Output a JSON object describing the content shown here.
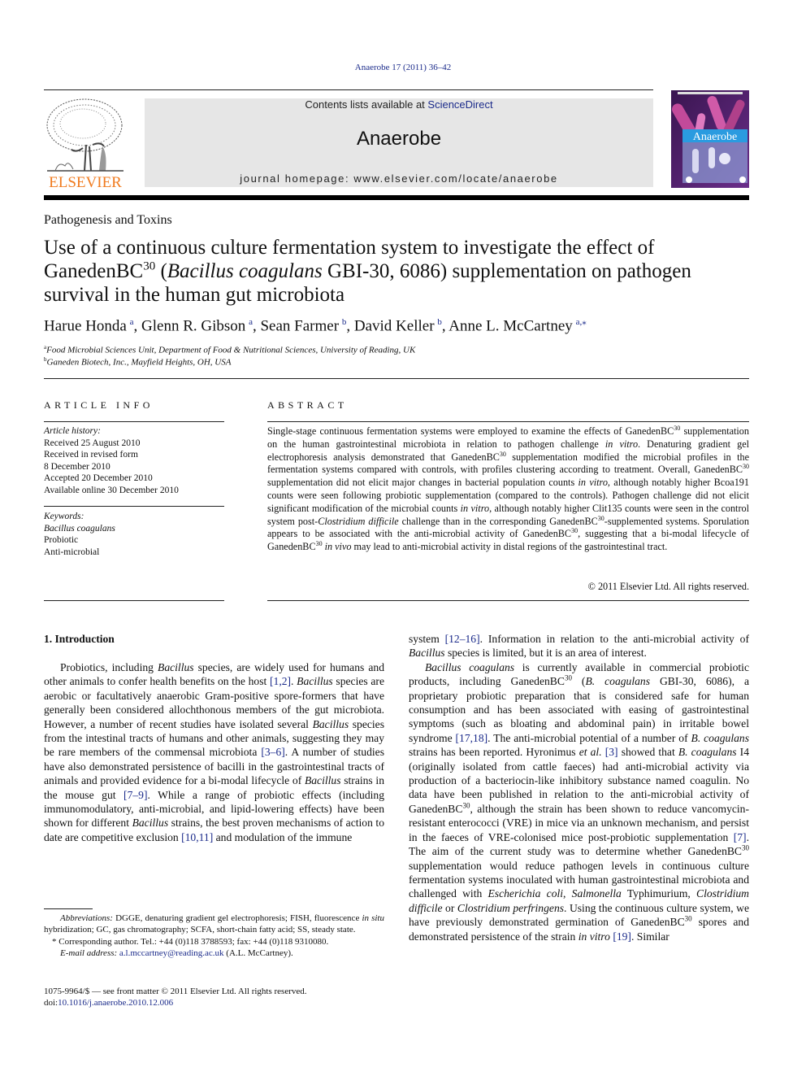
{
  "header": {
    "journal_ref": "Anaerobe 17 (2011) 36–42",
    "contents_prefix": "Contents lists available at ",
    "contents_link": "ScienceDirect",
    "journal_name": "Anaerobe",
    "homepage": "journal homepage: www.elsevier.com/locate/anaerobe",
    "publisher_logo_text": "ELSEVIER",
    "cover_title": "Anaerobe",
    "colors": {
      "elsevier_orange": "#f07b1f",
      "link_blue": "#1a2a8a",
      "masthead_gray": "#e6e6e6",
      "cover_blue": "#2a9be0",
      "cover_purple": "#5a2a7a"
    }
  },
  "article": {
    "section": "Pathogenesis and Toxins",
    "title_part1": "Use of a continuous culture fermentation system to investigate the effect of GanedenBC",
    "title_sup": "30",
    "title_part2": " (",
    "title_italic": "Bacillus coagulans",
    "title_part3": " GBI-30, 6086) supplementation on pathogen survival in the human gut microbiota",
    "authors": [
      {
        "name": "Harue Honda",
        "aff": "a"
      },
      {
        "name": "Glenn R. Gibson",
        "aff": "a"
      },
      {
        "name": "Sean Farmer",
        "aff": "b"
      },
      {
        "name": "David Keller",
        "aff": "b"
      },
      {
        "name": "Anne L. McCartney",
        "aff": "a,⁎"
      }
    ],
    "affiliations": [
      {
        "key": "a",
        "text": "Food Microbial Sciences Unit, Department of Food & Nutritional Sciences, University of Reading, UK"
      },
      {
        "key": "b",
        "text": "Ganeden Biotech, Inc., Mayfield Heights, OH, USA"
      }
    ]
  },
  "article_info": {
    "heading": "ARTICLE INFO",
    "history_label": "Article history:",
    "history": [
      "Received 25 August 2010",
      "Received in revised form",
      "8 December 2010",
      "Accepted 20 December 2010",
      "Available online 30 December 2010"
    ],
    "keywords_label": "Keywords:",
    "keywords": [
      "Bacillus coagulans",
      "Probiotic",
      "Anti-microbial"
    ]
  },
  "abstract": {
    "heading": "ABSTRACT",
    "s1": "Single-stage continuous fermentation systems were employed to examine the effects of GanedenBC",
    "s2": " supplementation on the human gastrointestinal microbiota in relation to pathogen challenge ",
    "s3": ". Denaturing gradient gel electrophoresis analysis demonstrated that GanedenBC",
    "s4": " supplementation modified the microbial profiles in the fermentation systems compared with controls, with profiles clustering according to treatment. Overall, GanedenBC",
    "s5": " supplementation did not elicit major changes in bacterial population counts ",
    "s6": ", although notably higher Bcoa191 counts were seen following probiotic supplementation (compared to the controls). Pathogen challenge did not elicit significant modification of the microbial counts ",
    "s7": ", although notably higher Clit135 counts were seen in the control system post-",
    "s8": " challenge than in the corresponding GanedenBC",
    "s9": "-supplemented systems. Sporulation appears to be associated with the anti-microbial activity of GanedenBC",
    "s10": ", suggesting that a bi-modal lifecycle of GanedenBC",
    "s11": " may lead to anti-microbial activity in distal regions of the gastrointestinal tract.",
    "sup": "30",
    "in_vitro": "in vitro",
    "in_vivo": "in vivo",
    "c_difficile": "Clostridium difficile",
    "copyright": "© 2011 Elsevier Ltd. All rights reserved."
  },
  "intro": {
    "heading": "1.  Introduction",
    "left": {
      "t1": "Probiotics, including ",
      "t2": " species, are widely used for humans and other animals to confer health benefits on the host ",
      "c1": "[1,2]",
      "t3": ". ",
      "t4": " species are aerobic or facultatively anaerobic Gram-positive spore-formers that have generally been considered allochthonous members of the gut microbiota. However, a number of recent studies have isolated several ",
      "t5": " species from the intestinal tracts of humans and other animals, suggesting they may be rare members of the commensal microbiota ",
      "c2": "[3–6]",
      "t6": ". A number of studies have also demonstrated persistence of bacilli in the gastrointestinal tracts of animals and provided evidence for a bi-modal lifecycle of ",
      "t7": " strains in the mouse gut ",
      "c3": "[7–9]",
      "t8": ". While a range of probiotic effects (including immunomodulatory, anti-microbial, and lipid-lowering effects) have been shown for different ",
      "t9": " strains, the best proven mechanisms of action to date are competitive exclusion ",
      "c4": "[10,11]",
      "t10": " and modulation of the immune",
      "bacillus": "Bacillus"
    },
    "right": {
      "p1a": "system ",
      "p1c": "[12–16]",
      "p1b": ". Information in relation to the anti-microbial activity of ",
      "p1d": " species is limited, but it is an area of interest.",
      "bacillus": "Bacillus",
      "b_coag_full": "Bacillus coagulans",
      "p2a": " is currently available in commercial probiotic products, including GanedenBC",
      "sup": "30",
      "p2b": " (",
      "b_coag": "B. coagulans",
      "p2c": " GBI-30, 6086), a proprietary probiotic preparation that is considered safe for human consumption and has been associated with easing of gastrointestinal symptoms (such as bloating and abdominal pain) in irritable bowel syndrome ",
      "c1": "[17,18]",
      "p2d": ". The anti-microbial potential of a number of ",
      "p2e": " strains has been reported. Hyronimus ",
      "etal": "et al.",
      "c2": "[3]",
      "p2f": " showed that ",
      "p2g": " I4 (originally isolated from cattle faeces) had anti-microbial activity via production of a bacteriocin-like inhibitory substance named coagulin. No data have been published in relation to the anti-microbial activity of GanedenBC",
      "p2h": ", although the strain has been shown to reduce vancomycin-resistant enterococci (VRE) in mice via an unknown mechanism, and persist in the faeces of VRE-colonised mice post-probiotic supplementation ",
      "c3": "[7]",
      "p2i": ". The aim of the current study was to determine whether GanedenBC",
      "p2j": " supplementation would reduce pathogen levels in continuous culture fermentation systems inoculated with human gastrointestinal microbiota and challenged with ",
      "e_coli": "Escherichia coli",
      "comma": ", ",
      "salmonella": "Salmonella",
      "p2k": " Typhimurium, ",
      "c_diff": "Clostridium difficile",
      "or": " or ",
      "c_perf": "Clostridium perfringens",
      "p2l": ". Using the continuous culture system, we have previously demonstrated germination of GanedenBC",
      "p2m": " spores and demonstrated persistence of the strain ",
      "in_vitro": "in vitro",
      "c4": "[19]",
      "p2n": ". Similar"
    }
  },
  "footnotes": {
    "abbr_label": "Abbreviations:",
    "abbr_a": " DGGE, denaturing gradient gel electrophoresis; FISH, fluorescence ",
    "in_situ": "in situ",
    "abbr_b": " hybridization; GC, gas chromatography; SCFA, short-chain fatty acid; SS, steady state.",
    "corr_mark": "*",
    "corr": " Corresponding author. Tel.: +44 (0)118 3788593; fax: +44 (0)118 9310080.",
    "email_label": "E-mail address:",
    "email": "a.l.mccartney@reading.ac.uk",
    "email_suffix": " (A.L. McCartney).",
    "issn": "1075-9964/$ — see front matter © 2011 Elsevier Ltd. All rights reserved.",
    "doi_prefix": "doi:",
    "doi": "10.1016/j.anaerobe.2010.12.006"
  }
}
